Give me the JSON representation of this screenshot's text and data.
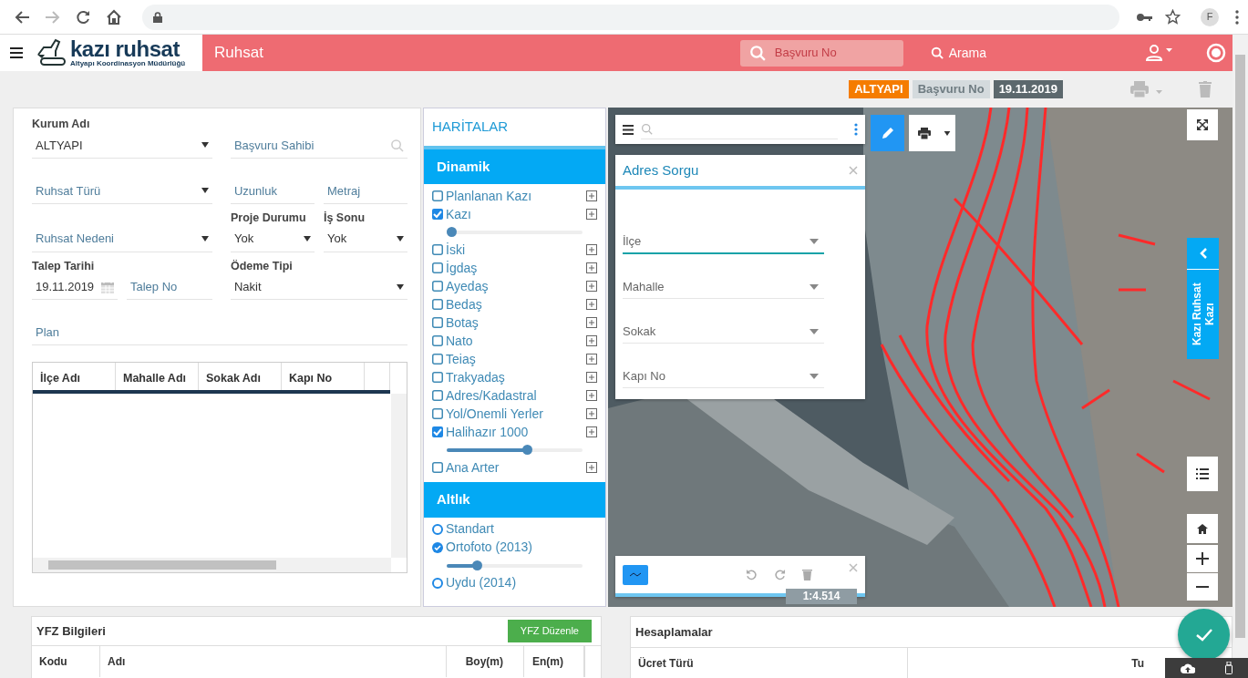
{
  "browser": {
    "profile_initial": "F"
  },
  "header": {
    "logo_title": "kazı ruhsat",
    "logo_subtitle": "Altyapı Koordinasyon Müdürlüğü",
    "page_title": "Ruhsat",
    "search": {
      "placeholder": "Başvuru No"
    },
    "search_link": "Arama"
  },
  "toolbar": {
    "badges": [
      {
        "text": "ALTYAPI",
        "kind": "org"
      },
      {
        "text": "Başvuru No",
        "kind": "muted"
      },
      {
        "text": "19.11.2019",
        "kind": "date"
      }
    ]
  },
  "form": {
    "rows": [
      {
        "left": [
          {
            "kind": "select",
            "label": "Kurum Adı",
            "value": "ALTYAPI"
          }
        ],
        "right": [
          {
            "kind": "search",
            "placeholder": "Başvuru Sahibi"
          }
        ]
      },
      {
        "left": [
          {
            "kind": "select",
            "placeholder": "Ruhsat Türü"
          }
        ],
        "right": [
          {
            "kind": "text",
            "placeholder": "Uzunluk"
          },
          {
            "kind": "text",
            "placeholder": "Metraj"
          }
        ]
      },
      {
        "left": [
          {
            "kind": "select",
            "placeholder": "Ruhsat Nedeni"
          }
        ],
        "right": [
          {
            "kind": "select",
            "label": "Proje Durumu",
            "value": "Yok"
          },
          {
            "kind": "select",
            "label": "İş Sonu",
            "value": "Yok"
          }
        ]
      },
      {
        "left": [
          {
            "kind": "date",
            "label": "Talep Tarihi",
            "value": "19.11.2019"
          },
          {
            "kind": "text",
            "placeholder": "Talep No"
          }
        ],
        "right": [
          {
            "kind": "select",
            "label": "Ödeme Tipi",
            "value": "Nakit"
          }
        ]
      },
      {
        "full": [
          {
            "kind": "text",
            "placeholder": "Plan"
          }
        ]
      }
    ],
    "address_table": {
      "columns": [
        "İlçe Adı",
        "Mahalle Adı",
        "Sokak Adı",
        "Kapı No"
      ]
    }
  },
  "layers": {
    "title": "HARİTALAR",
    "sections": [
      {
        "title": "Dinamik",
        "kind": "check",
        "items": [
          {
            "label": "Planlanan Kazı",
            "checked": false
          },
          {
            "label": "Kazı",
            "checked": true,
            "level": 0
          },
          {
            "label": "İski",
            "checked": false
          },
          {
            "label": "İgdaş",
            "checked": false
          },
          {
            "label": "Ayedaş",
            "checked": false
          },
          {
            "label": "Bedaş",
            "checked": false
          },
          {
            "label": "Botaş",
            "checked": false
          },
          {
            "label": "Nato",
            "checked": false
          },
          {
            "label": "Teiaş",
            "checked": false
          },
          {
            "label": "Trakyadaş",
            "checked": false
          },
          {
            "label": "Adres/Kadastral",
            "checked": false
          },
          {
            "label": "Yol/Onemli Yerler",
            "checked": false
          },
          {
            "label": "Halihazır 1000",
            "checked": true,
            "level": 0.6
          },
          {
            "label": "Ana Arter",
            "checked": false
          }
        ]
      },
      {
        "title": "Altlık",
        "kind": "radio",
        "items": [
          {
            "label": "Standart",
            "selected": false
          },
          {
            "label": "Ortofoto (2013)",
            "selected": true,
            "level": 0.2
          },
          {
            "label": "Uydu (2014)",
            "selected": false
          }
        ]
      }
    ]
  },
  "map": {
    "address_panel": {
      "title": "Adres Sorgu",
      "fields": [
        {
          "placeholder": "İlçe",
          "focused": true
        },
        {
          "placeholder": "Mahalle",
          "focused": false
        },
        {
          "placeholder": "Sokak",
          "focused": false
        },
        {
          "placeholder": "Kapı No",
          "focused": false
        }
      ]
    },
    "side_tab": "Kazı Ruhsat Kazı",
    "scale": "1:4.514"
  },
  "bottom": {
    "yfz": {
      "title": "YFZ Bilgileri",
      "button": "YFZ Düzenle",
      "columns": [
        "Kodu",
        "Adı",
        "Boy(m)",
        "En(m)"
      ]
    },
    "hesap": {
      "title": "Hesaplamalar",
      "columns": [
        "Ücret Türü",
        "Tu"
      ]
    }
  }
}
